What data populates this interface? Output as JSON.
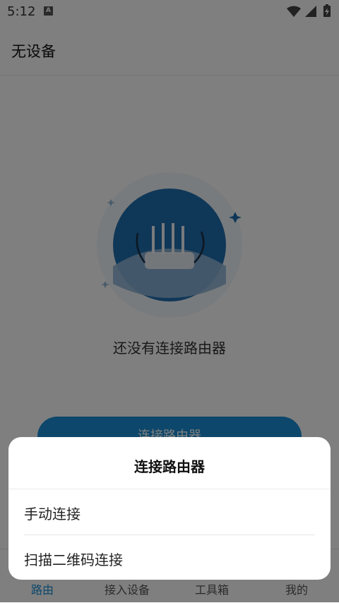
{
  "status_bar": {
    "time": "5:12",
    "notification_badge": "A",
    "icons": [
      "wifi-icon",
      "cell-signal-icon",
      "battery-charging-icon"
    ]
  },
  "app_bar": {
    "title": "无设备"
  },
  "empty_state": {
    "message": "还没有连接路由器",
    "illustration": "router-illustration"
  },
  "primary_button": {
    "label": "连接路由器"
  },
  "tab_bar": {
    "tabs": [
      {
        "label": "路由",
        "active": true,
        "icon": "router-tab-icon"
      },
      {
        "label": "接入设备",
        "active": false,
        "icon": "devices-tab-icon"
      },
      {
        "label": "工具箱",
        "active": false,
        "icon": "toolbox-tab-icon"
      },
      {
        "label": "我的",
        "active": false,
        "icon": "profile-tab-icon"
      }
    ]
  },
  "bottom_sheet": {
    "title": "连接路由器",
    "items": [
      {
        "label": "手动连接"
      },
      {
        "label": "扫描二维码连接"
      }
    ]
  },
  "colors": {
    "accent": "#1a8fd6",
    "overlay": "rgba(0,0,0,0.5)"
  }
}
